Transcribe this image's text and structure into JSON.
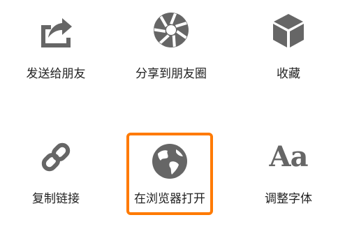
{
  "actions": {
    "send_to_friend": {
      "label": "发送给朋友",
      "icon": "share-forward-icon"
    },
    "share_moments": {
      "label": "分享到朋友圈",
      "icon": "moments-aperture-icon"
    },
    "favorite": {
      "label": "收藏",
      "icon": "cube-icon"
    },
    "copy_link": {
      "label": "复制链接",
      "icon": "link-icon"
    },
    "open_in_browser": {
      "label": "在浏览器打开",
      "icon": "globe-icon",
      "highlighted": true
    },
    "adjust_font": {
      "label": "调整字体",
      "icon": "font-icon",
      "icon_text": "Aa"
    }
  },
  "colors": {
    "icon": "#666666",
    "text": "#222222",
    "highlight": "#ff7a00",
    "background": "#ffffff"
  }
}
